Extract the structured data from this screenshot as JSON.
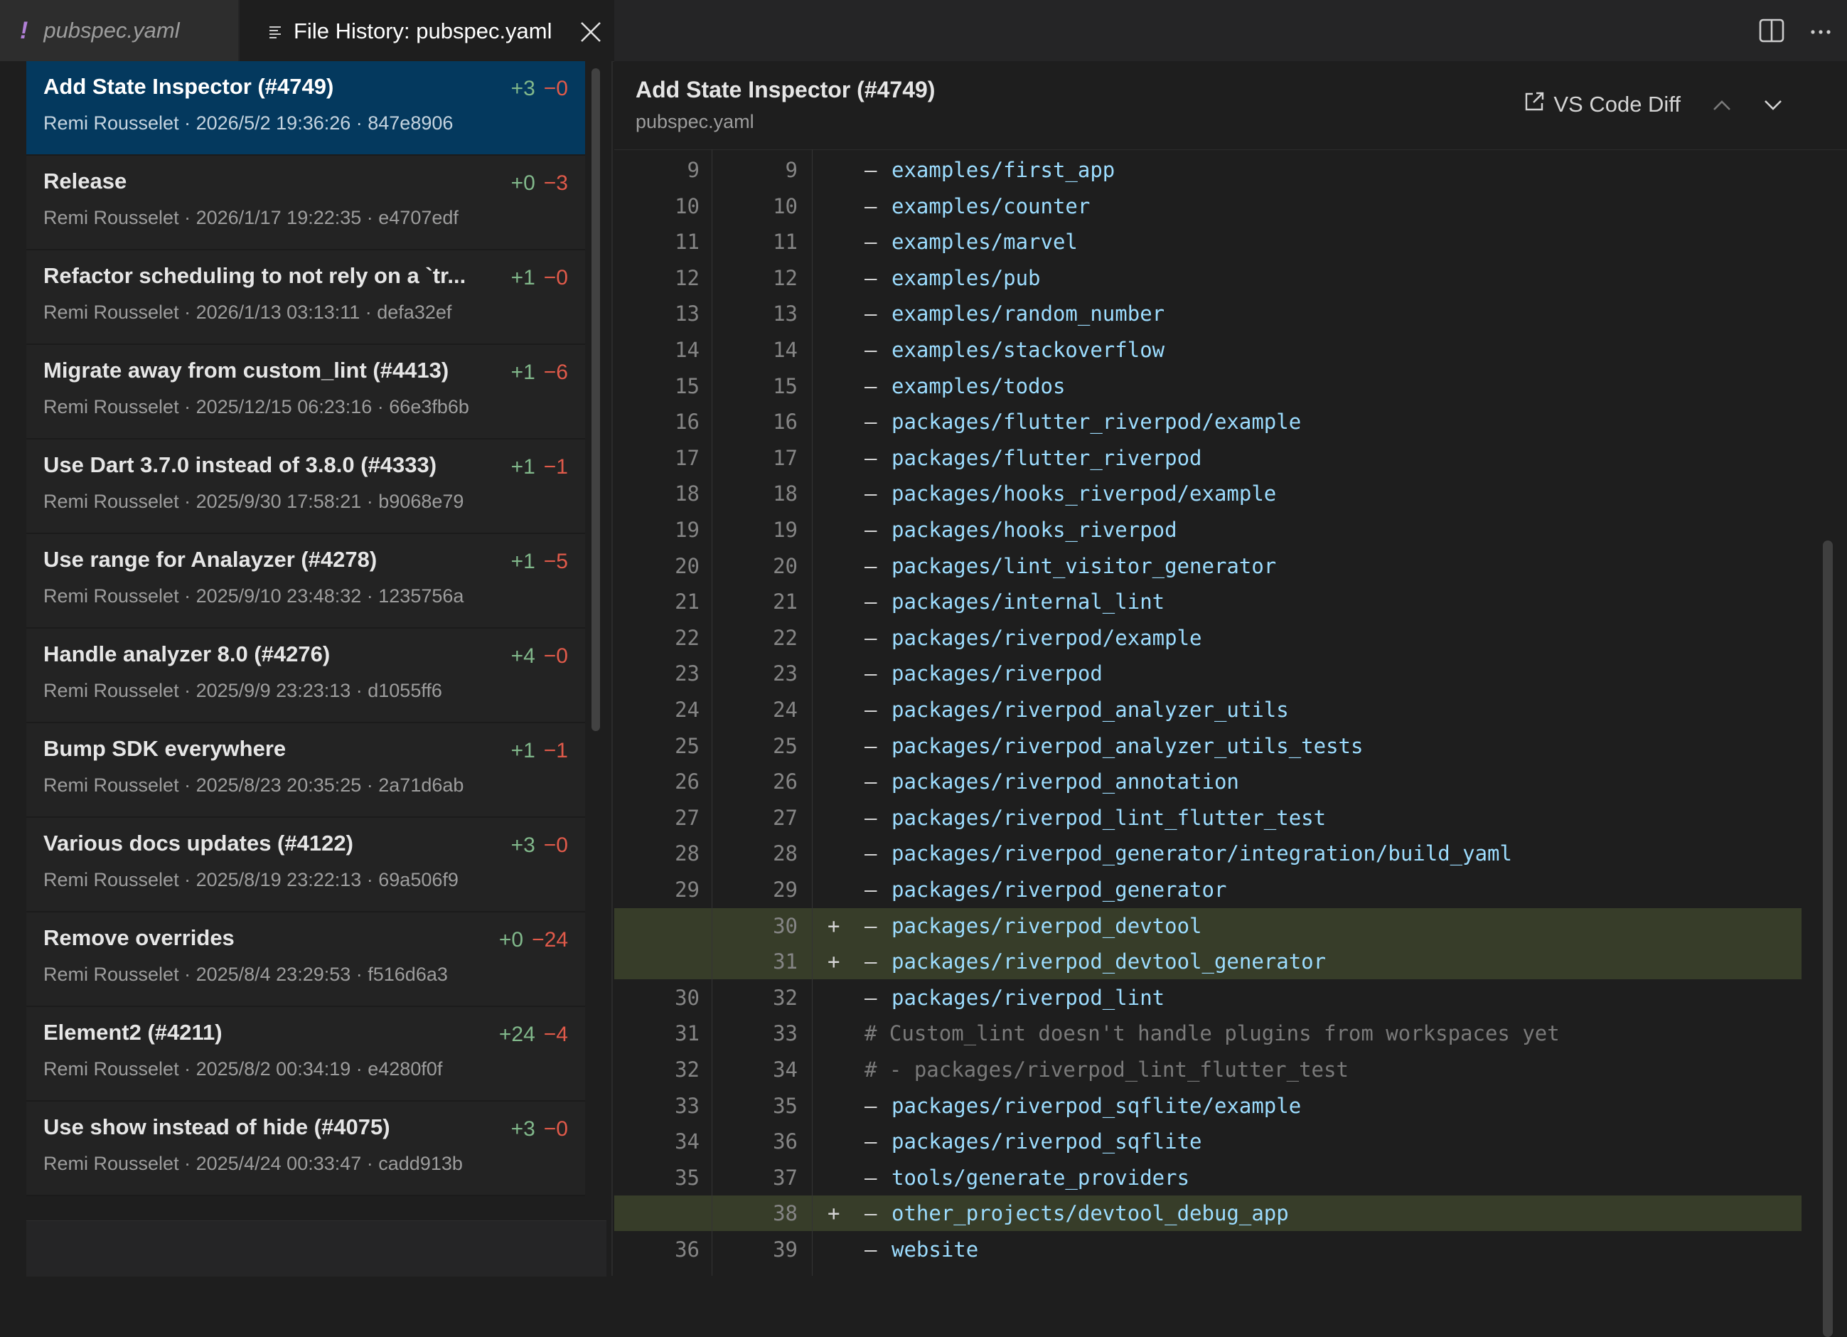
{
  "tabs": {
    "inactive_label": "pubspec.yaml",
    "inactive_icon": "!",
    "active_label": "File History: pubspec.yaml"
  },
  "commits": [
    {
      "title": "Add State Inspector (#4749)",
      "meta": "Remi Rousselet · 2026/5/2 19:36:26 · 847e8906",
      "add": "+3",
      "del": "−0"
    },
    {
      "title": "Release",
      "meta": "Remi Rousselet · 2026/1/17 19:22:35 · e4707edf",
      "add": "+0",
      "del": "−3"
    },
    {
      "title": "Refactor scheduling to not rely on a `tr...",
      "meta": "Remi Rousselet · 2026/1/13 03:13:11 · defa32ef",
      "add": "+1",
      "del": "−0"
    },
    {
      "title": "Migrate away from custom_lint (#4413)",
      "meta": "Remi Rousselet · 2025/12/15 06:23:16 · 66e3fb6b",
      "add": "+1",
      "del": "−6"
    },
    {
      "title": "Use Dart 3.7.0 instead of 3.8.0 (#4333)",
      "meta": "Remi Rousselet · 2025/9/30 17:58:21 · b9068e79",
      "add": "+1",
      "del": "−1"
    },
    {
      "title": "Use range for Analayzer (#4278)",
      "meta": "Remi Rousselet · 2025/9/10 23:48:32 · 1235756a",
      "add": "+1",
      "del": "−5"
    },
    {
      "title": "Handle analyzer 8.0 (#4276)",
      "meta": "Remi Rousselet · 2025/9/9 23:23:13 · d1055ff6",
      "add": "+4",
      "del": "−0"
    },
    {
      "title": "Bump SDK everywhere",
      "meta": "Remi Rousselet · 2025/8/23 20:35:25 · 2a71d6ab",
      "add": "+1",
      "del": "−1"
    },
    {
      "title": "Various docs updates (#4122)",
      "meta": "Remi Rousselet · 2025/8/19 23:22:13 · 69a506f9",
      "add": "+3",
      "del": "−0"
    },
    {
      "title": "Remove overrides",
      "meta": "Remi Rousselet · 2025/8/4 23:29:53 · f516d6a3",
      "add": "+0",
      "del": "−24"
    },
    {
      "title": "Element2 (#4211)",
      "meta": "Remi Rousselet · 2025/8/2 00:34:19 · e4280f0f",
      "add": "+24",
      "del": "−4"
    },
    {
      "title": "Use show instead of hide (#4075)",
      "meta": "Remi Rousselet · 2025/4/24 00:33:47 · cadd913b",
      "add": "+3",
      "del": "−0"
    }
  ],
  "diff": {
    "title": "Add State Inspector (#4749)",
    "file": "pubspec.yaml",
    "vscode_diff_label": "VS Code Diff",
    "lines": [
      {
        "old": "9",
        "new": "9",
        "text": "examples/first_app"
      },
      {
        "old": "10",
        "new": "10",
        "text": "examples/counter"
      },
      {
        "old": "11",
        "new": "11",
        "text": "examples/marvel"
      },
      {
        "old": "12",
        "new": "12",
        "text": "examples/pub"
      },
      {
        "old": "13",
        "new": "13",
        "text": "examples/random_number"
      },
      {
        "old": "14",
        "new": "14",
        "text": "examples/stackoverflow"
      },
      {
        "old": "15",
        "new": "15",
        "text": "examples/todos"
      },
      {
        "old": "16",
        "new": "16",
        "text": "packages/flutter_riverpod/example"
      },
      {
        "old": "17",
        "new": "17",
        "text": "packages/flutter_riverpod"
      },
      {
        "old": "18",
        "new": "18",
        "text": "packages/hooks_riverpod/example"
      },
      {
        "old": "19",
        "new": "19",
        "text": "packages/hooks_riverpod"
      },
      {
        "old": "20",
        "new": "20",
        "text": "packages/lint_visitor_generator"
      },
      {
        "old": "21",
        "new": "21",
        "text": "packages/internal_lint"
      },
      {
        "old": "22",
        "new": "22",
        "text": "packages/riverpod/example"
      },
      {
        "old": "23",
        "new": "23",
        "text": "packages/riverpod"
      },
      {
        "old": "24",
        "new": "24",
        "text": "packages/riverpod_analyzer_utils"
      },
      {
        "old": "25",
        "new": "25",
        "text": "packages/riverpod_analyzer_utils_tests"
      },
      {
        "old": "26",
        "new": "26",
        "text": "packages/riverpod_annotation"
      },
      {
        "old": "27",
        "new": "27",
        "text": "packages/riverpod_lint_flutter_test"
      },
      {
        "old": "28",
        "new": "28",
        "text": "packages/riverpod_generator/integration/build_yaml"
      },
      {
        "old": "29",
        "new": "29",
        "text": "packages/riverpod_generator"
      },
      {
        "old": "",
        "new": "30",
        "text": "packages/riverpod_devtool",
        "added": true
      },
      {
        "old": "",
        "new": "31",
        "text": "packages/riverpod_devtool_generator",
        "added": true
      },
      {
        "old": "30",
        "new": "32",
        "text": "packages/riverpod_lint"
      },
      {
        "old": "31",
        "new": "33",
        "comment": "# Custom_lint doesn't handle plugins from workspaces yet"
      },
      {
        "old": "32",
        "new": "34",
        "comment": "# - packages/riverpod_lint_flutter_test"
      },
      {
        "old": "33",
        "new": "35",
        "text": "packages/riverpod_sqflite/example"
      },
      {
        "old": "34",
        "new": "36",
        "text": "packages/riverpod_sqflite"
      },
      {
        "old": "35",
        "new": "37",
        "text": "tools/generate_providers"
      },
      {
        "old": "",
        "new": "38",
        "text": "other_projects/devtool_debug_app",
        "added": true
      },
      {
        "old": "36",
        "new": "39",
        "text": "website"
      }
    ]
  },
  "icons": {
    "lines": "list-lines-icon",
    "close": "close-icon",
    "split": "split-editor-icon",
    "more": "more-actions-icon",
    "external": "open-external-icon",
    "up": "chevron-up-icon",
    "down": "chevron-down-icon"
  },
  "colors": {
    "selected": "#04395e",
    "added_bg": "#373d29",
    "additions": "#81b88b",
    "deletions": "#e05a4a",
    "code_text": "#9cdcfe"
  }
}
